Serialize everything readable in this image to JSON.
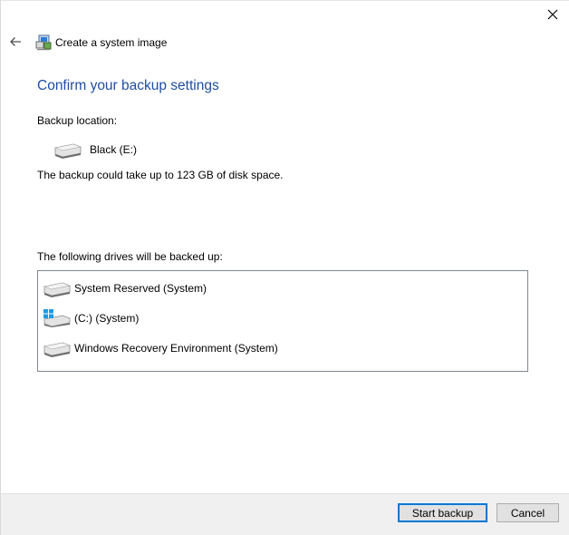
{
  "window": {
    "title": "Create a system image",
    "close_icon": "close-icon",
    "back_icon": "back-arrow-icon"
  },
  "page": {
    "heading": "Confirm your backup settings",
    "backup_location_label": "Backup location:",
    "backup_location": {
      "name": "Black (E:)",
      "icon": "hard-drive-icon"
    },
    "space_text": "The backup could take up to 123 GB of disk space.",
    "drives_label": "The following drives will be backed up:",
    "drives": [
      {
        "name": "System Reserved (System)",
        "icon": "hard-drive-icon"
      },
      {
        "name": "(C:) (System)",
        "icon": "windows-drive-icon"
      },
      {
        "name": "Windows Recovery Environment (System)",
        "icon": "hard-drive-icon"
      }
    ]
  },
  "footer": {
    "start_label": "Start backup",
    "cancel_label": "Cancel"
  },
  "colors": {
    "heading": "#1f4ea3",
    "primary_border": "#0078d7",
    "footer_bg": "#f0f0f0"
  }
}
